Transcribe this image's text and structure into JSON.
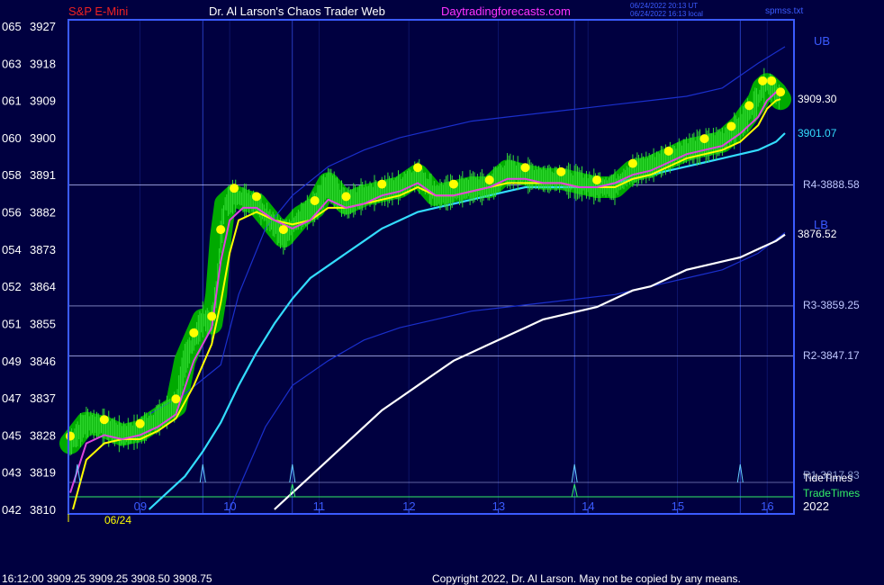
{
  "header": {
    "symbol": "S&P E-Mini",
    "site_title": "Dr. Al Larson's Chaos Trader Web",
    "site_url": "Daytradingforecasts.com",
    "timestamp_ut": "06/24/2022 20:13 UT",
    "timestamp_local": "06/24/2022 16:13 local",
    "filename": "spmss.txt"
  },
  "footer": {
    "quote": "16:12:00  3909.25 3909.25 3908.50 3908.75",
    "copyright": "Copyright 2022, Dr. Al Larson. May not be copied by any means."
  },
  "colors": {
    "background": "#000040",
    "axis": "#3b5bff",
    "price": "#ffff00",
    "band": "#00aa00",
    "green_line": "#33dd33",
    "magenta": "#dd44dd",
    "cyan": "#33ddff",
    "white_ma": "#ffffff",
    "channel": "#1a2fcc",
    "level": "#c0c8ff",
    "spike": "#66ccff",
    "tradetimes": "#33ee66",
    "red": "#ee2222",
    "header_title": "#ffffff",
    "url": "#ff33ff"
  },
  "chart_data": {
    "type": "line",
    "x_unit": "hour",
    "xlim": [
      8.1,
      16.2
    ],
    "ylim": [
      3810,
      3927
    ],
    "y_ticks": [
      3927,
      3918,
      3909,
      3900,
      3891,
      3882,
      3873,
      3864,
      3855,
      3846,
      3837,
      3828,
      3819,
      3810
    ],
    "y_tick_prefix": [
      "065",
      "063",
      "061",
      "060",
      "058",
      "056",
      "054",
      "052",
      "051",
      "049",
      "047",
      "045",
      "043",
      "042"
    ],
    "x_ticks": [
      {
        "x": 8.9,
        "label": "09"
      },
      {
        "x": 9.9,
        "label": "10"
      },
      {
        "x": 10.9,
        "label": "11"
      },
      {
        "x": 11.9,
        "label": "12"
      },
      {
        "x": 12.9,
        "label": "13"
      },
      {
        "x": 13.9,
        "label": "14"
      },
      {
        "x": 14.9,
        "label": "15"
      },
      {
        "x": 15.9,
        "label": "16"
      }
    ],
    "date_label": "06/24",
    "year_label": "2022",
    "vertical_markers": [
      9.6,
      10.6,
      13.75,
      15.6
    ],
    "series": [
      {
        "key": "price",
        "x": [
          8.12,
          8.3,
          8.5,
          8.7,
          8.9,
          9.1,
          9.3,
          9.4,
          9.5,
          9.6,
          9.7,
          9.75,
          9.8,
          9.85,
          9.95,
          10.05,
          10.2,
          10.35,
          10.5,
          10.7,
          10.85,
          11.0,
          11.2,
          11.4,
          11.6,
          11.8,
          12.0,
          12.2,
          12.4,
          12.6,
          12.8,
          13.0,
          13.2,
          13.4,
          13.6,
          13.8,
          14.0,
          14.2,
          14.4,
          14.6,
          14.8,
          15.0,
          15.2,
          15.4,
          15.5,
          15.6,
          15.7,
          15.8,
          15.85,
          15.9,
          15.95,
          16.0,
          16.05
        ],
        "y": [
          3826,
          3831,
          3830,
          3828,
          3829,
          3832,
          3835,
          3846,
          3851,
          3856,
          3855,
          3862,
          3876,
          3884,
          3886,
          3885,
          3884,
          3880,
          3876,
          3881,
          3883,
          3889,
          3884,
          3886,
          3887,
          3888,
          3891,
          3886,
          3887,
          3888,
          3888,
          3892,
          3891,
          3890,
          3890,
          3889,
          3888,
          3888,
          3892,
          3893,
          3895,
          3897,
          3898,
          3899,
          3901,
          3903,
          3906,
          3909,
          3912,
          3913,
          3912,
          3911,
          3909.3
        ]
      },
      {
        "key": "magenta_ma",
        "x": [
          8.12,
          8.3,
          8.5,
          8.7,
          8.9,
          9.1,
          9.3,
          9.5,
          9.7,
          9.8,
          9.9,
          10.05,
          10.2,
          10.4,
          10.6,
          10.8,
          11.0,
          11.2,
          11.4,
          11.6,
          11.8,
          12.0,
          12.2,
          12.4,
          12.6,
          12.8,
          13.0,
          13.2,
          13.4,
          13.6,
          13.8,
          14.0,
          14.2,
          14.4,
          14.6,
          14.8,
          15.0,
          15.2,
          15.4,
          15.6,
          15.8,
          15.9,
          16.0,
          16.05
        ],
        "y": [
          3814,
          3826,
          3828,
          3827,
          3828,
          3830,
          3833,
          3846,
          3854,
          3870,
          3880,
          3883,
          3883,
          3880,
          3878,
          3880,
          3885,
          3883,
          3884,
          3886,
          3887,
          3889,
          3886,
          3886,
          3887,
          3888,
          3890,
          3890,
          3889,
          3889,
          3888,
          3888,
          3889,
          3891,
          3892,
          3894,
          3896,
          3897,
          3898,
          3901,
          3905,
          3909,
          3911,
          3910
        ]
      },
      {
        "key": "yellow_ma",
        "x": [
          8.15,
          8.3,
          8.5,
          8.7,
          8.9,
          9.1,
          9.3,
          9.5,
          9.7,
          9.8,
          9.9,
          10.0,
          10.2,
          10.4,
          10.6,
          10.8,
          11.0,
          11.2,
          11.4,
          11.6,
          11.8,
          12.0,
          12.2,
          12.4,
          12.6,
          12.8,
          13.0,
          13.2,
          13.4,
          13.6,
          13.8,
          14.0,
          14.2,
          14.4,
          14.6,
          14.8,
          15.0,
          15.2,
          15.4,
          15.6,
          15.8,
          15.9,
          16.0,
          16.05
        ],
        "y": [
          3810,
          3822,
          3826,
          3827,
          3827,
          3829,
          3832,
          3840,
          3850,
          3860,
          3872,
          3880,
          3882,
          3880,
          3879,
          3880,
          3883,
          3883,
          3884,
          3885,
          3886,
          3888,
          3886,
          3886,
          3887,
          3888,
          3889,
          3889,
          3889,
          3889,
          3888,
          3888,
          3888,
          3890,
          3891,
          3893,
          3895,
          3896,
          3897,
          3899,
          3903,
          3907,
          3909,
          3909.3
        ]
      },
      {
        "key": "cyan_ma",
        "x": [
          9.0,
          9.2,
          9.4,
          9.6,
          9.8,
          10.0,
          10.2,
          10.4,
          10.6,
          10.8,
          11.0,
          11.2,
          11.4,
          11.6,
          11.8,
          12.0,
          12.2,
          12.4,
          12.6,
          12.8,
          13.0,
          13.2,
          13.4,
          13.6,
          13.8,
          14.0,
          14.2,
          14.4,
          14.6,
          14.8,
          15.0,
          15.2,
          15.4,
          15.6,
          15.8,
          16.0,
          16.1
        ],
        "y": [
          3810,
          3814,
          3818,
          3824,
          3831,
          3840,
          3848,
          3855,
          3861,
          3866,
          3869,
          3872,
          3875,
          3878,
          3880,
          3882,
          3883,
          3884,
          3885,
          3886,
          3887,
          3888,
          3888,
          3888,
          3888,
          3888,
          3889,
          3890,
          3891,
          3892,
          3893,
          3894,
          3895,
          3896,
          3897,
          3899,
          3901.07
        ]
      },
      {
        "key": "white_ma",
        "x": [
          10.4,
          10.6,
          10.8,
          11.0,
          11.2,
          11.4,
          11.6,
          11.8,
          12.0,
          12.2,
          12.4,
          12.6,
          12.8,
          13.0,
          13.2,
          13.4,
          13.6,
          13.8,
          14.0,
          14.2,
          14.4,
          14.6,
          14.8,
          15.0,
          15.2,
          15.4,
          15.6,
          15.8,
          16.0,
          16.1
        ],
        "y": [
          3810,
          3814,
          3818,
          3822,
          3826,
          3830,
          3834,
          3837,
          3840,
          3843,
          3846,
          3848,
          3850,
          3852,
          3854,
          3856,
          3857,
          3858,
          3859,
          3861,
          3863,
          3864,
          3866,
          3868,
          3869,
          3870,
          3871,
          3873,
          3875,
          3876.52
        ]
      },
      {
        "key": "upper_channel",
        "x": [
          9.0,
          9.4,
          9.8,
          10.0,
          10.3,
          10.6,
          11.0,
          11.4,
          11.8,
          12.2,
          12.6,
          13.0,
          13.4,
          13.8,
          14.2,
          14.6,
          15.0,
          15.4,
          15.8,
          16.1
        ],
        "y": [
          3833,
          3838,
          3845,
          3862,
          3878,
          3886,
          3893,
          3897,
          3900,
          3902,
          3904,
          3905,
          3906,
          3907,
          3908,
          3909,
          3910,
          3912,
          3918,
          3922
        ]
      },
      {
        "key": "lower_channel",
        "x": [
          9.9,
          10.3,
          10.6,
          11.0,
          11.4,
          11.8,
          12.2,
          12.6,
          13.0,
          13.4,
          13.8,
          14.2,
          14.6,
          15.0,
          15.4,
          15.8,
          16.1
        ],
        "y": [
          3810,
          3830,
          3840,
          3846,
          3851,
          3854,
          3856,
          3858,
          3859,
          3860,
          3861,
          3862,
          3864,
          3866,
          3868,
          3872,
          3877
        ]
      }
    ],
    "levels": [
      {
        "key": "R4",
        "value": 3888.58,
        "label": "R4-3888.58"
      },
      {
        "key": "R3",
        "value": 3859.25,
        "label": "R3-3859.25"
      },
      {
        "key": "R2",
        "value": 3847.17,
        "label": "R2-3847.17"
      }
    ],
    "value_labels": [
      {
        "key": "last_price",
        "label": "3909.30"
      },
      {
        "key": "cyan_last",
        "label": "3901.07"
      },
      {
        "key": "white_last",
        "label": "3876.52"
      }
    ],
    "channel_labels": {
      "upper": "UB",
      "lower": "LB"
    },
    "right_labels": [
      "R1-3817.83",
      "TideTimes",
      "TradeTimes"
    ]
  }
}
